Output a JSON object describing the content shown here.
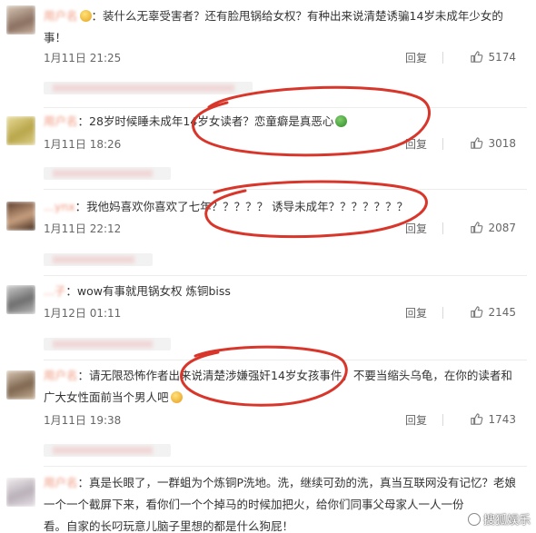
{
  "comments": [
    {
      "username": "用户名",
      "text": "：装什么无辜受害者？还有脸甩锅给女权？有种出来说清楚诱骗14岁未成年少女的事！",
      "time": "1月11日 21:25",
      "reply": "回复",
      "likes": "5174"
    },
    {
      "username": "用户名",
      "text": "：28岁时候睡未成年14岁女读者？恋童癖是真恶心",
      "time": "1月11日 18:26",
      "reply": "回复",
      "likes": "3018"
    },
    {
      "username": "...ynx",
      "text": "：我他妈喜欢你喜欢了七年？？？？？ 诱导未成年？？？？？？？",
      "time": "1月11日 22:12",
      "reply": "回复",
      "likes": "2087"
    },
    {
      "username": "...子",
      "text": "：wow有事就甩锅女权 炼铜biss",
      "time": "1月12日 01:11",
      "reply": "回复",
      "likes": "2145"
    },
    {
      "username": "用户名",
      "text": "：请无限恐怖作者出来说清楚涉嫌强奸14岁女孩事件，不要当缩头乌龟，在你的读者和广大女性面前当个男人吧",
      "time": "1月11日 19:38",
      "reply": "回复",
      "likes": "1743"
    },
    {
      "username": "用户名",
      "text": "：真是长眼了，一群蛆为个炼铜P洗地。洗，继续可劲的洗，真当互联网没有记忆？老娘一个一个截屏下来，看你们一个个掉马的时候加把火，给你们同事父母家人一人一份",
      "text2": "看。自家的长叼玩意儿脑子里想的都是什么狗屁！"
    }
  ],
  "watermark": "搜狐娱乐",
  "colors": {
    "annotation": "#d9362b",
    "username": "#eb7350"
  }
}
